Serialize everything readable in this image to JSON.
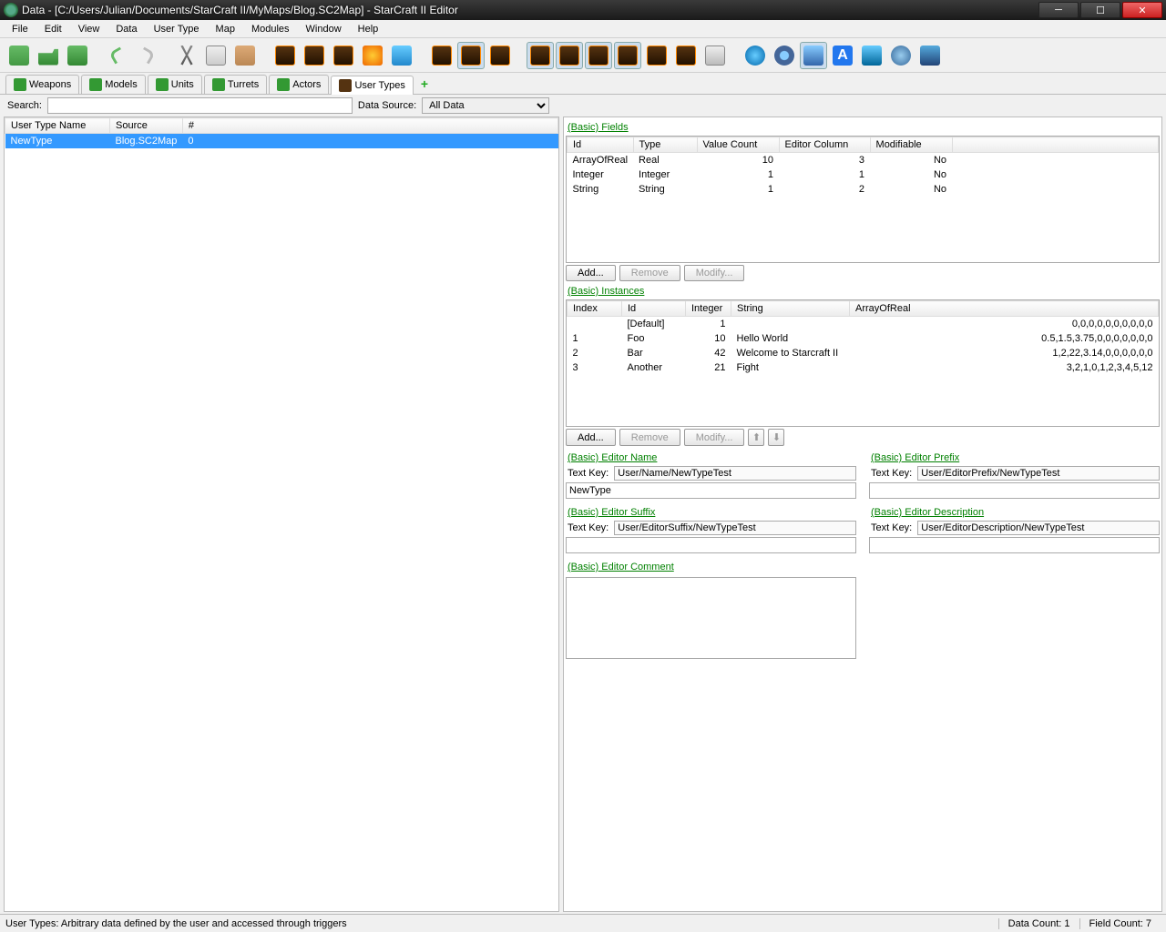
{
  "window": {
    "title": "Data - [C:/Users/Julian/Documents/StarCraft II/MyMaps/Blog.SC2Map] - StarCraft II Editor"
  },
  "menu": [
    "File",
    "Edit",
    "View",
    "Data",
    "User Type",
    "Map",
    "Modules",
    "Window",
    "Help"
  ],
  "tabs": [
    {
      "label": "Weapons"
    },
    {
      "label": "Models"
    },
    {
      "label": "Units"
    },
    {
      "label": "Turrets"
    },
    {
      "label": "Actors"
    },
    {
      "label": "User Types",
      "active": true
    }
  ],
  "filter": {
    "search_label": "Search:",
    "datasource_label": "Data Source:",
    "datasource_value": "All Data"
  },
  "typeTable": {
    "headers": [
      "User Type Name",
      "Source",
      "#"
    ],
    "rows": [
      {
        "name": "NewType",
        "source": "Blog.SC2Map",
        "count": "0"
      }
    ]
  },
  "fields": {
    "title": "(Basic) Fields",
    "headers": [
      "Id",
      "Type",
      "Value Count",
      "Editor Column",
      "Modifiable"
    ],
    "rows": [
      {
        "id": "ArrayOfReal",
        "type": "Real",
        "vc": "10",
        "ec": "3",
        "mod": "No"
      },
      {
        "id": "Integer",
        "type": "Integer",
        "vc": "1",
        "ec": "1",
        "mod": "No"
      },
      {
        "id": "String",
        "type": "String",
        "vc": "1",
        "ec": "2",
        "mod": "No"
      }
    ],
    "add": "Add...",
    "remove": "Remove",
    "modify": "Modify..."
  },
  "instances": {
    "title": "(Basic) Instances",
    "headers": [
      "Index",
      "Id",
      "Integer",
      "String",
      "ArrayOfReal"
    ],
    "rows": [
      {
        "idx": "",
        "id": "[Default]",
        "int": "1",
        "str": "",
        "arr": "0,0,0,0,0,0,0,0,0,0"
      },
      {
        "idx": "1",
        "id": "Foo",
        "int": "10",
        "str": "Hello World",
        "arr": "0.5,1.5,3.75,0,0,0,0,0,0,0"
      },
      {
        "idx": "2",
        "id": "Bar",
        "int": "42",
        "str": "Welcome to Starcraft II",
        "arr": "1,2,22,3.14,0,0,0,0,0,0"
      },
      {
        "idx": "3",
        "id": "Another",
        "int": "21",
        "str": "Fight",
        "arr": "3,2,1,0,1,2,3,4,5,12"
      }
    ],
    "add": "Add...",
    "remove": "Remove",
    "modify": "Modify..."
  },
  "editorName": {
    "title": "(Basic) Editor Name",
    "keylabel": "Text Key:",
    "key": "User/Name/NewTypeTest",
    "value": "NewType"
  },
  "editorPrefix": {
    "title": "(Basic) Editor Prefix",
    "keylabel": "Text Key:",
    "key": "User/EditorPrefix/NewTypeTest",
    "value": ""
  },
  "editorSuffix": {
    "title": "(Basic) Editor Suffix",
    "keylabel": "Text Key:",
    "key": "User/EditorSuffix/NewTypeTest",
    "value": ""
  },
  "editorDesc": {
    "title": "(Basic) Editor Description",
    "keylabel": "Text Key:",
    "key": "User/EditorDescription/NewTypeTest",
    "value": ""
  },
  "editorComment": {
    "title": "(Basic) Editor Comment",
    "value": ""
  },
  "status": {
    "left": "User Types: Arbitrary data defined by the user and accessed through triggers",
    "datacount": "Data Count: 1",
    "fieldcount": "Field Count: 7"
  }
}
